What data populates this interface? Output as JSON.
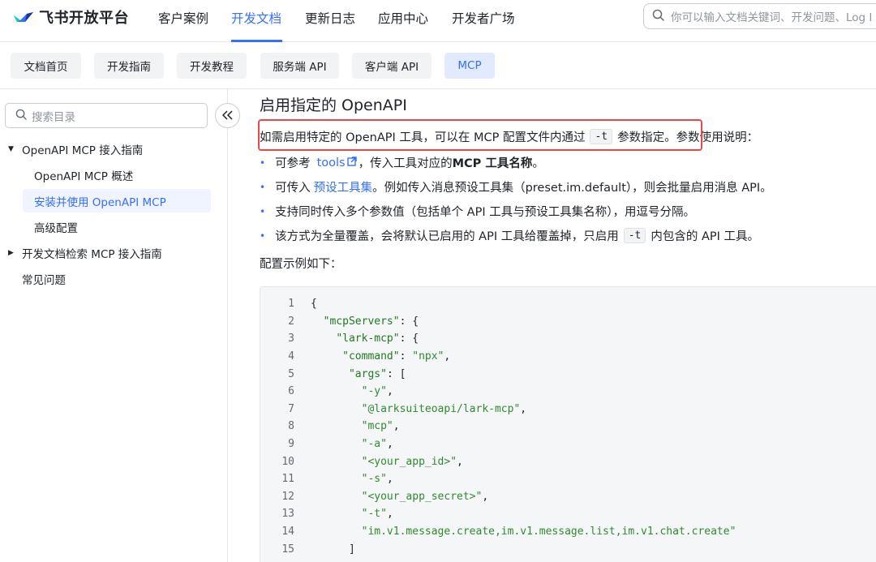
{
  "header": {
    "logo_text": "飞书开放平台",
    "nav": [
      "客户案例",
      "开发文档",
      "更新日志",
      "应用中心",
      "开发者广场"
    ],
    "active_nav": "开发文档",
    "search_placeholder": "你可以输入文档关键词、开发问题、Log I"
  },
  "subtabs": {
    "items": [
      "文档首页",
      "开发指南",
      "开发教程",
      "服务端 API",
      "客户端 API",
      "MCP"
    ],
    "active": "MCP"
  },
  "sidebar": {
    "search_placeholder": "搜索目录",
    "tree": {
      "group1": "OpenAPI MCP 接入指南",
      "child1": "OpenAPI MCP 概述",
      "child2": "安装并使用 OpenAPI MCP",
      "child3": "高级配置",
      "group2": "开发文档检索 MCP 接入指南",
      "group3": "常见问题"
    }
  },
  "content": {
    "heading": "启用指定的 OpenAPI",
    "para": {
      "before": "如需启用特定的 OpenAPI 工具，可以在 MCP 配置文件内通过",
      "code": "-t",
      "after_in_box": "参数指定。",
      "after": "参数使用说明："
    },
    "bullets": {
      "b1": {
        "prefix": "可参考",
        "link": "tools",
        "mid": "，传入工具对应的",
        "strong": "MCP 工具名称",
        "end": "。"
      },
      "b2": {
        "prefix": "可传入",
        "link": "预设工具集",
        "rest": "。例如传入消息预设工具集（preset.im.default），则会批量启用消息 API。"
      },
      "b3": "支持同时传入多个参数值（包括单个 API 工具与预设工具集名称），用逗号分隔。",
      "b4": {
        "before": "该方式为全量覆盖，会将默认已启用的 API 工具给覆盖掉，只启用",
        "code": "-t",
        "after": "内包含的 API 工具。"
      }
    },
    "config_label": "配置示例如下：",
    "code_lines": [
      "{",
      "  \"mcpServers\": {",
      "    \"lark-mcp\": {",
      "     \"command\": \"npx\",",
      "      \"args\": [",
      "        \"-y\",",
      "        \"@larksuiteoapi/lark-mcp\",",
      "        \"mcp\",",
      "        \"-a\",",
      "        \"<your_app_id>\",",
      "        \"-s\",",
      "        \"<your_app_secret>\",",
      "        \"-t\",",
      "        \"im.v1.message.create,im.v1.message.list,im.v1.chat.create\"",
      "      ]"
    ],
    "line_numbers": [
      "1",
      "2",
      "3",
      "4",
      "5",
      "6",
      "7",
      "8",
      "9",
      "10",
      "11",
      "12",
      "13",
      "14",
      "15"
    ]
  },
  "colors": {
    "accent": "#3370ff",
    "highlight_box": "#e5484d"
  },
  "icons": [
    "logo-icon",
    "search-icon",
    "collapse-icon",
    "caret-down-icon",
    "caret-right-icon",
    "external-link-icon"
  ]
}
